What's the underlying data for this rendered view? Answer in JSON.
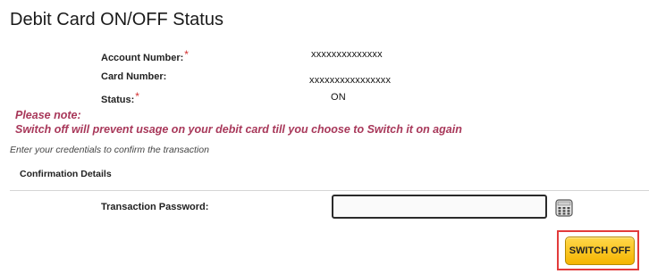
{
  "page": {
    "title": "Debit Card ON/OFF Status"
  },
  "card_info": {
    "account_number_label": "Account Number:",
    "account_number_value": "xxxxxxxxxxxxxx",
    "card_number_label": "Card Number:",
    "card_number_value": "xxxxxxxxxxxxxxxx",
    "status_label": "Status:",
    "status_value": "ON",
    "required_marker": "*"
  },
  "note": {
    "heading": "Please note:",
    "message": "Switch off will prevent usage on your debit card till you choose to Switch it on again"
  },
  "instruction": "Enter your credentials to confirm the transaction",
  "confirmation": {
    "section_title": "Confirmation Details",
    "password_label": "Transaction Password:",
    "password_value": "",
    "keypad_icon": "virtual-keypad-icon"
  },
  "actions": {
    "switch_off_label": "SWITCH OFF"
  },
  "colors": {
    "note_text": "#a8385a",
    "required_marker": "#d32f2f",
    "button_gradient_top": "#ffd84a",
    "button_gradient_bottom": "#f5b400",
    "highlight_frame": "#e23b3b"
  }
}
